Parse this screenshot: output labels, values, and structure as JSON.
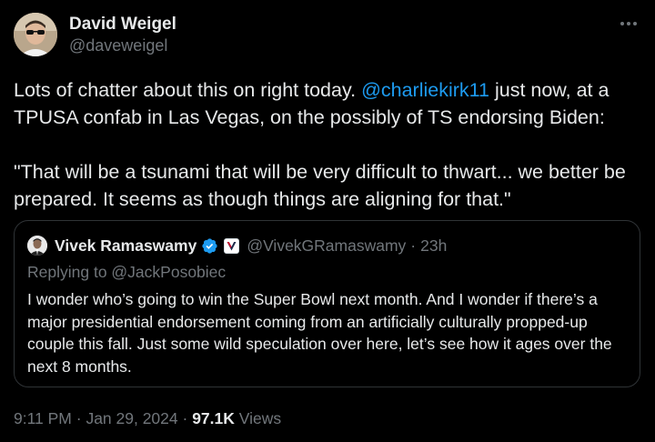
{
  "author": {
    "name": "David Weigel",
    "handle": "@daveweigel"
  },
  "tweet": {
    "text_before_mention": "Lots of chatter about this on right today. ",
    "mention": "@charliekirk11",
    "text_after_mention": " just now, at a TPUSA confab in Las Vegas, on the possibly of TS endorsing Biden:",
    "quote_paragraph": "\"That will be a tsunami that will be very difficult to thwart... we better be prepared. It seems as though things are aligning for that.\""
  },
  "quoted_tweet": {
    "name": "Vivek Ramaswamy",
    "handle": "@VivekGRamaswamy",
    "separator": "·",
    "time": "23h",
    "replying_to": "Replying to @JackPosobiec",
    "text": "I wonder who’s going to win the Super Bowl next month. And I wonder if there’s a major presidential endorsement coming from an artificially culturally propped-up couple this fall. Just some wild speculation over here, let’s see how it ages over the next 8 months."
  },
  "meta": {
    "time": "9:11 PM",
    "separator": " · ",
    "date": "Jan 29, 2024",
    "views_count": "97.1K",
    "views_label": " Views"
  },
  "colors": {
    "background": "#000000",
    "text": "#e7e9ea",
    "secondary": "#71767b",
    "link": "#1d9bf0",
    "border": "#2f3336"
  },
  "icons": {
    "more": "more-horizontal-icon",
    "verified": "verified-badge-icon",
    "affiliate": "affiliate-v-badge-icon"
  }
}
